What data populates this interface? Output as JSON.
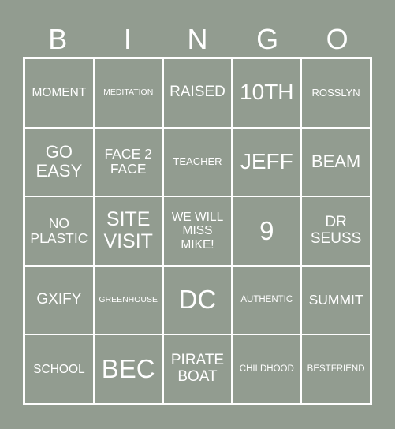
{
  "header": [
    "B",
    "I",
    "N",
    "G",
    "O"
  ],
  "cells": [
    [
      "MOMENT",
      "MEDITATION",
      "RAISED",
      "10TH",
      "ROSSLYN"
    ],
    [
      "GO EASY",
      "FACE 2 FACE",
      "TEACHER",
      "JEFF",
      "BEAM"
    ],
    [
      "NO PLASTIC",
      "SITE VISIT",
      "WE WILL MISS MIKE!",
      "9",
      "DR SEUSS"
    ],
    [
      "GXIFY",
      "GREENHOUSE",
      "DC",
      "AUTHENTIC",
      "SUMMIT"
    ],
    [
      "SCHOOL",
      "BEC",
      "PIRATE BOAT",
      "CHILDHOOD",
      "BESTFRIEND"
    ]
  ],
  "colors": {
    "background": "#929c90",
    "lines": "#ffffff",
    "text": "#ffffff"
  }
}
